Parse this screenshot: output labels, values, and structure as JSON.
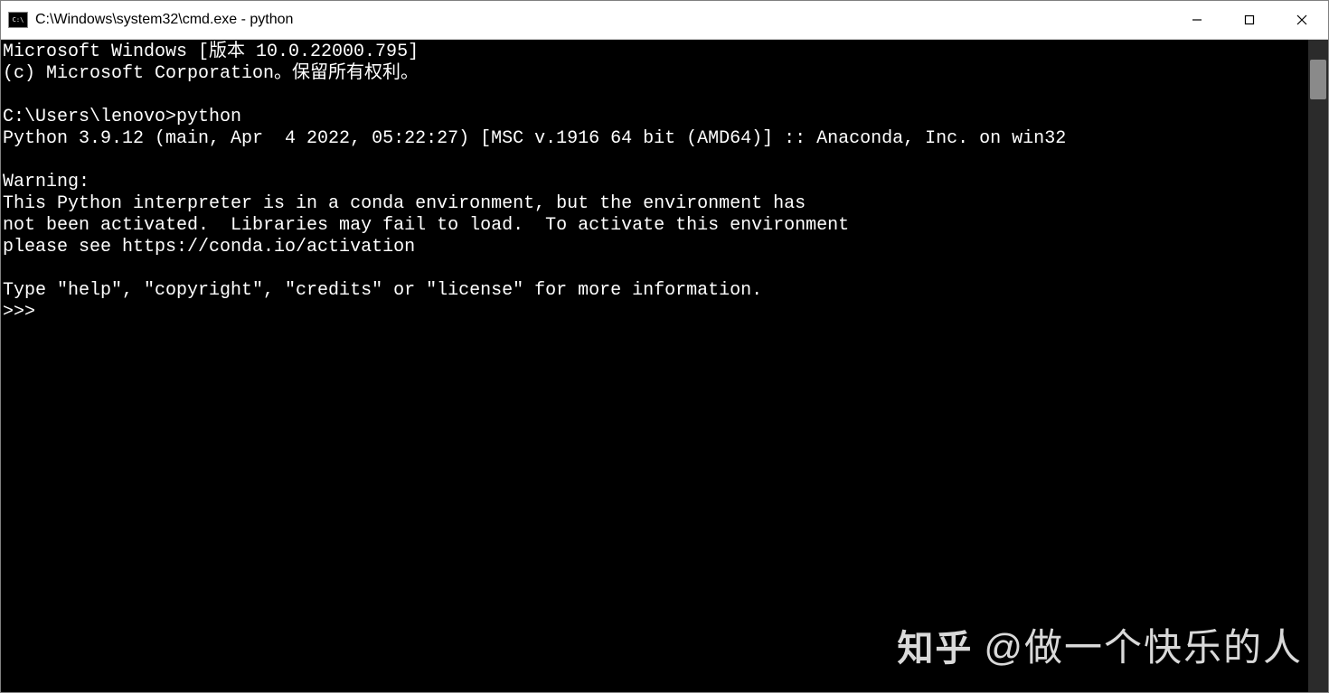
{
  "window": {
    "title": "C:\\Windows\\system32\\cmd.exe - python"
  },
  "terminal": {
    "lines": [
      "Microsoft Windows [版本 10.0.22000.795]",
      "(c) Microsoft Corporation。保留所有权利。",
      "",
      "C:\\Users\\lenovo>python",
      "Python 3.9.12 (main, Apr  4 2022, 05:22:27) [MSC v.1916 64 bit (AMD64)] :: Anaconda, Inc. on win32",
      "",
      "Warning:",
      "This Python interpreter is in a conda environment, but the environment has",
      "not been activated.  Libraries may fail to load.  To activate this environment",
      "please see https://conda.io/activation",
      "",
      "Type \"help\", \"copyright\", \"credits\" or \"license\" for more information.",
      ">>>"
    ]
  },
  "watermark": {
    "logo": "知乎",
    "text": "@做一个快乐的人"
  }
}
